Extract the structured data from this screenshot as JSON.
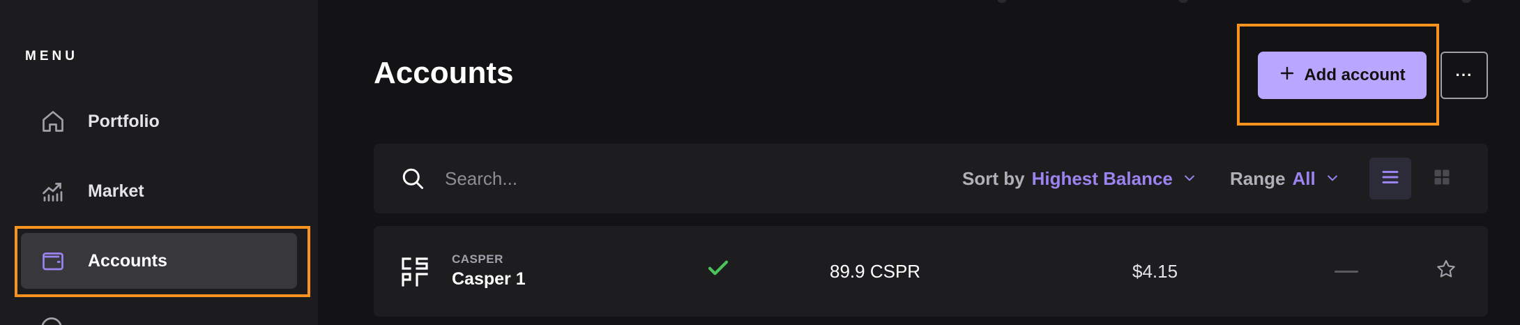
{
  "sidebar": {
    "menu_label": "MENU",
    "items": [
      {
        "label": "Portfolio",
        "icon": "home-icon"
      },
      {
        "label": "Market",
        "icon": "chart-icon"
      },
      {
        "label": "Accounts",
        "icon": "wallet-icon",
        "active": true
      }
    ]
  },
  "header": {
    "title": "Accounts",
    "add_button_label": "Add account",
    "more_button_label": "···"
  },
  "toolbar": {
    "search_placeholder": "Search...",
    "sort_label": "Sort by",
    "sort_value": "Highest Balance",
    "range_label": "Range",
    "range_value": "All"
  },
  "accounts": [
    {
      "symbol": "CASPER",
      "name": "Casper 1",
      "balance": "89.9 CSPR",
      "usd_value": "$4.15"
    }
  ],
  "colors": {
    "accent": "#b9a6ff",
    "accent_text": "#9b83f0",
    "highlight": "#f7931e",
    "success": "#4cc35a"
  }
}
